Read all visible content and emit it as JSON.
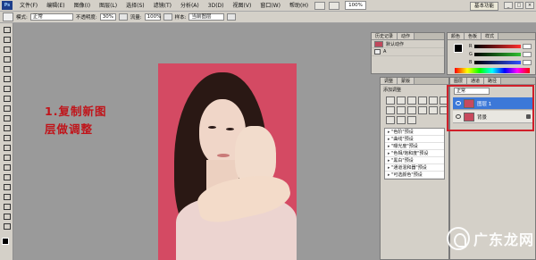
{
  "menubar": {
    "app_logo": "Ps",
    "items": [
      "文件(F)",
      "编辑(E)",
      "图像(I)",
      "图层(L)",
      "选择(S)",
      "滤镜(T)",
      "分析(A)",
      "3D(D)",
      "视图(V)",
      "窗口(W)",
      "帮助(H)"
    ],
    "zoom": "100%",
    "workspace": "基本功能"
  },
  "optionsbar": {
    "mode_label": "模式:",
    "mode_value": "正常",
    "opacity_label": "不透明度:",
    "opacity_value": "30%",
    "flow_label": "流量:",
    "flow_value": "100%",
    "sample_label": "样本:",
    "sample_value": "当前图层"
  },
  "caption": {
    "text": "1.复制新图\n层做调整"
  },
  "history_panel": {
    "tabs": [
      "历史记录",
      "动作"
    ],
    "rows": [
      "默认动作",
      "A"
    ]
  },
  "color_panel": {
    "tabs": [
      "颜色",
      "色板",
      "样式"
    ],
    "channels": [
      {
        "name": "R",
        "color": "#ff3030"
      },
      {
        "name": "G",
        "color": "#30c030"
      },
      {
        "name": "B",
        "color": "#3050ff"
      }
    ]
  },
  "adjust_panel": {
    "tabs": [
      "调整",
      "蒙版"
    ],
    "title": "添加调整",
    "presets": [
      "\"色阶\"预设",
      "\"曲线\"预设",
      "\"曝光度\"预设",
      "\"色相/饱和度\"预设",
      "\"黑白\"预设",
      "\"通道混和器\"预设",
      "\"可选颜色\"预设"
    ]
  },
  "layers_panel": {
    "tabs": [
      "图层",
      "通道",
      "路径"
    ],
    "blend_mode": "正常",
    "layers": [
      {
        "name": "图层 1",
        "selected": true
      },
      {
        "name": "背景",
        "selected": false
      }
    ]
  },
  "watermark": {
    "text": "广东龙网"
  }
}
